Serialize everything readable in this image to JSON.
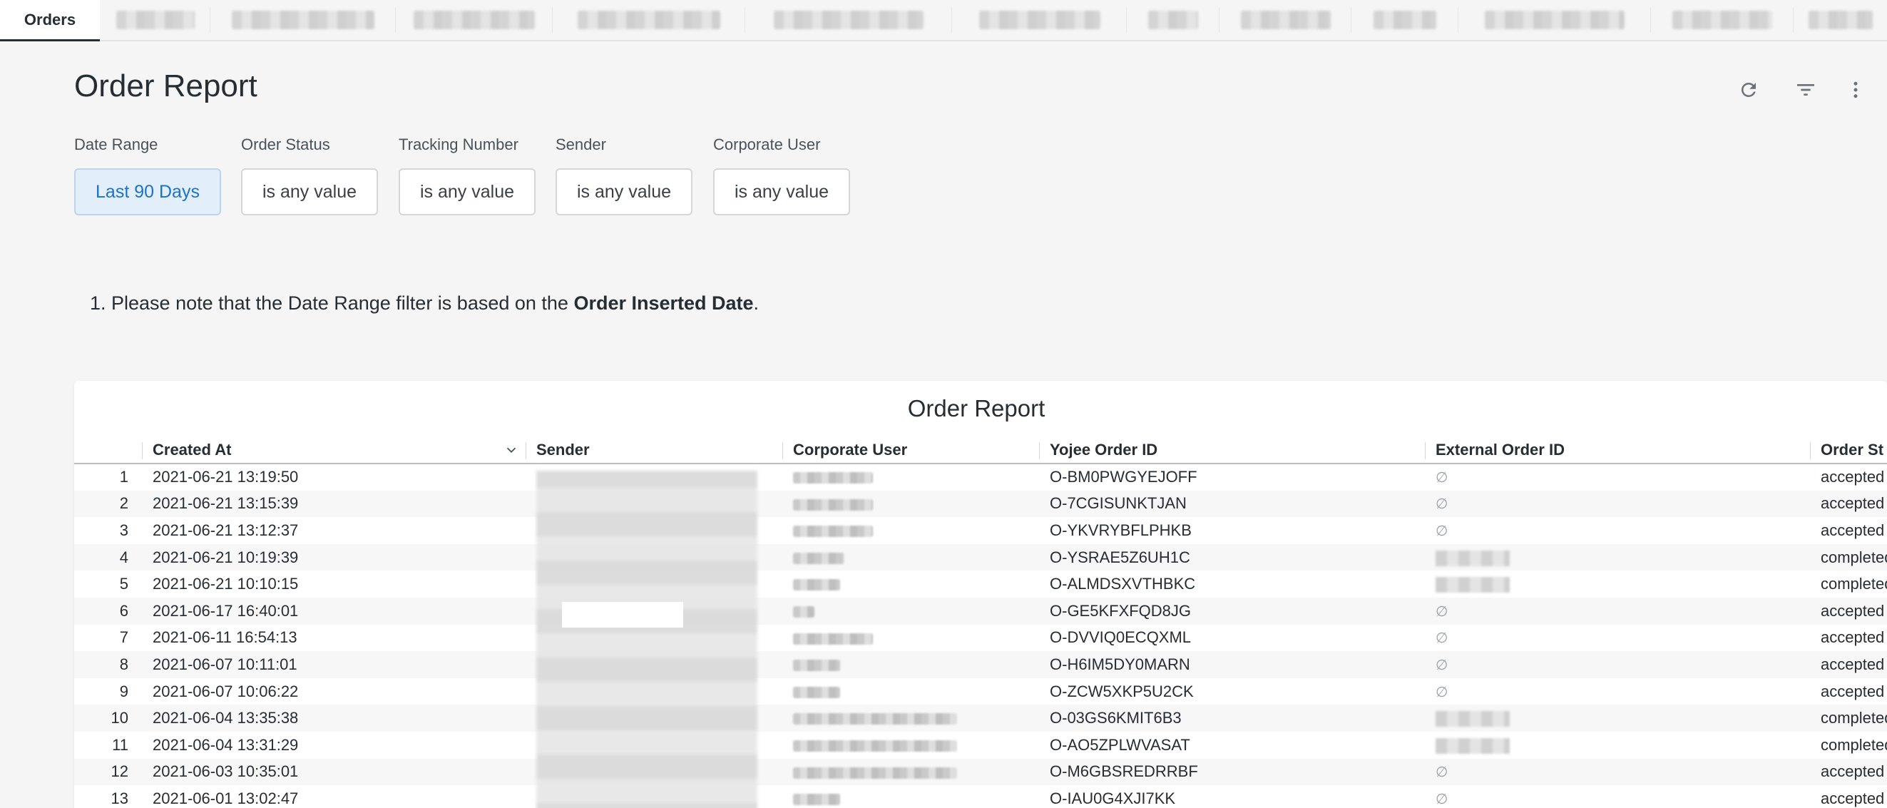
{
  "tabs": {
    "active_label": "Orders"
  },
  "header": {
    "title": "Order Report",
    "icons": [
      "refresh-icon",
      "filter-icon",
      "more-vertical-icon"
    ]
  },
  "filters": [
    {
      "label": "Date Range",
      "value": "Last 90 Days",
      "active": true
    },
    {
      "label": "Order Status",
      "value": "is any value",
      "active": false
    },
    {
      "label": "Tracking Number",
      "value": "is any value",
      "active": false
    },
    {
      "label": "Sender",
      "value": "is any value",
      "active": false
    },
    {
      "label": "Corporate User",
      "value": "is any value",
      "active": false
    }
  ],
  "note": {
    "prefix": "1. Please note that the Date Range filter is based on the ",
    "bold": "Order Inserted Date",
    "suffix": "."
  },
  "table": {
    "title": "Order Report",
    "columns": [
      "Created At",
      "Sender",
      "Corporate User",
      "Yojee Order ID",
      "External Order ID",
      "Order St"
    ],
    "null_symbol": "∅",
    "rows": [
      {
        "n": "1",
        "created": "2021-06-21 13:19:50",
        "yojee_id": "O-BM0PWGYEJOFF",
        "external_null": true,
        "status": "accepted"
      },
      {
        "n": "2",
        "created": "2021-06-21 13:15:39",
        "yojee_id": "O-7CGISUNKTJAN",
        "external_null": true,
        "status": "accepted"
      },
      {
        "n": "3",
        "created": "2021-06-21 13:12:37",
        "yojee_id": "O-YKVRYBFLPHKB",
        "external_null": true,
        "status": "accepted"
      },
      {
        "n": "4",
        "created": "2021-06-21 10:19:39",
        "yojee_id": "O-YSRAE5Z6UH1C",
        "external_null": false,
        "status": "completed"
      },
      {
        "n": "5",
        "created": "2021-06-21 10:10:15",
        "yojee_id": "O-ALMDSXVTHBKC",
        "external_null": false,
        "status": "completed"
      },
      {
        "n": "6",
        "created": "2021-06-17 16:40:01",
        "yojee_id": "O-GE5KFXFQD8JG",
        "external_null": true,
        "status": "accepted"
      },
      {
        "n": "7",
        "created": "2021-06-11 16:54:13",
        "yojee_id": "O-DVVIQ0ECQXML",
        "external_null": true,
        "status": "accepted"
      },
      {
        "n": "8",
        "created": "2021-06-07 10:11:01",
        "yojee_id": "O-H6IM5DY0MARN",
        "external_null": true,
        "status": "accepted"
      },
      {
        "n": "9",
        "created": "2021-06-07 10:06:22",
        "yojee_id": "O-ZCW5XKP5U2CK",
        "external_null": true,
        "status": "accepted"
      },
      {
        "n": "10",
        "created": "2021-06-04 13:35:38",
        "yojee_id": "O-03GS6KMIT6B3",
        "external_null": false,
        "status": "completed"
      },
      {
        "n": "11",
        "created": "2021-06-04 13:31:29",
        "yojee_id": "O-AO5ZPLWVASAT",
        "external_null": false,
        "status": "completed"
      },
      {
        "n": "12",
        "created": "2021-06-03 10:35:01",
        "yojee_id": "O-M6GBSREDRRBF",
        "external_null": true,
        "status": "accepted"
      },
      {
        "n": "13",
        "created": "2021-06-01 13:02:47",
        "yojee_id": "O-IAU0G4XJI7KK",
        "external_null": true,
        "status": "accepted"
      }
    ]
  },
  "colors": {
    "accent": "#1a73c8",
    "active_filter_bg": "#e3eefb",
    "page_bg": "#f5f5f5"
  }
}
